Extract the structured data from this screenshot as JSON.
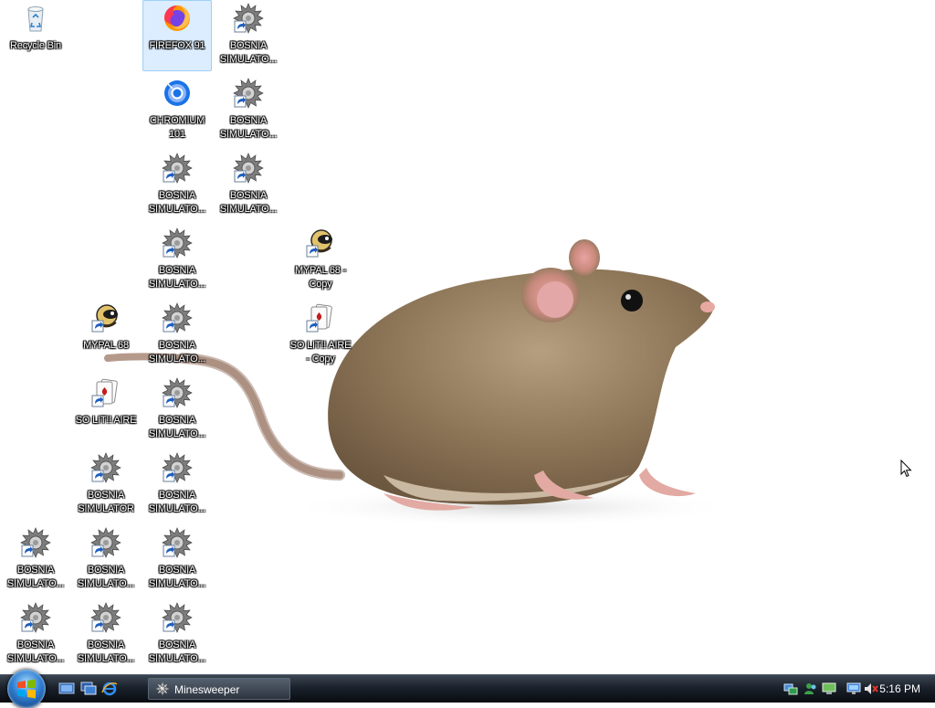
{
  "desktop": {
    "icons": [
      {
        "label": "Recycle Bin",
        "type": "recycle"
      },
      {
        "label": "FIREFOX 91",
        "type": "firefox"
      },
      {
        "label": "BOSNIA\nSIMULATO...",
        "type": "sim"
      },
      {
        "label": "CHROMIUM\n101",
        "type": "chromium"
      },
      {
        "label": "BOSNIA\nSIMULATO...",
        "type": "sim"
      },
      {
        "label": "BOSNIA\nSIMULATO...",
        "type": "sim"
      },
      {
        "label": "BOSNIA\nSIMULATO...",
        "type": "sim"
      },
      {
        "label": "BOSNIA\nSIMULATO...",
        "type": "sim"
      },
      {
        "label": "MYPAL 68 -\nCopy",
        "type": "mypal"
      },
      {
        "label": "MYPAL 68",
        "type": "mypal"
      },
      {
        "label": "BOSNIA\nSIMULATO...",
        "type": "sim"
      },
      {
        "label": "SO LIT!! AIRE\n- Copy",
        "type": "cards"
      },
      {
        "label": "SO LIT!! AIRE",
        "type": "cards"
      },
      {
        "label": "BOSNIA\nSIMULATO...",
        "type": "sim"
      },
      {
        "label": "BOSNIA\nSIMULATOR",
        "type": "sim"
      },
      {
        "label": "BOSNIA\nSIMULATO...",
        "type": "sim"
      },
      {
        "label": "BOSNIA\nSIMULATO...",
        "type": "sim"
      },
      {
        "label": "BOSNIA\nSIMULATO...",
        "type": "sim"
      },
      {
        "label": "BOSNIA\nSIMULATO...",
        "type": "sim"
      },
      {
        "label": "BOSNIA\nSIMULATO...",
        "type": "sim"
      },
      {
        "label": "BOSNIA\nSIMULATO...",
        "type": "sim"
      },
      {
        "label": "BOSNIA\nSIMULATO...",
        "type": "sim"
      }
    ]
  },
  "taskbar": {
    "quick_launch": [
      "show-desktop-icon",
      "switch-windows-icon",
      "internet-explorer-icon"
    ],
    "tasks": [
      {
        "label": "Minesweeper"
      }
    ],
    "tray_icons": [
      "network-icon",
      "users-icon",
      "display-icon",
      "monitor-icon",
      "volume-muted-icon"
    ],
    "clock": "5:16 PM"
  }
}
